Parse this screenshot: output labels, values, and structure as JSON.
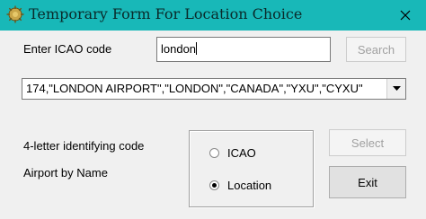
{
  "window": {
    "title": "Temporary Form For Location Choice",
    "close_label": "✕"
  },
  "search": {
    "label": "Enter ICAO code",
    "value": "london",
    "button_label": "Search",
    "button_enabled": false
  },
  "results": {
    "selected_value": "174,\"LONDON AIRPORT\",\"LONDON\",\"CANADA\",\"YXU\",\"CYXU\""
  },
  "options": {
    "label_icao": "4-letter identifying code",
    "label_name": "Airport by Name",
    "radio_icao": "ICAO",
    "radio_location": "Location",
    "selected": "Location"
  },
  "buttons": {
    "select_label": "Select",
    "select_enabled": false,
    "exit_label": "Exit"
  },
  "colors": {
    "titlebar": "#18b8b8",
    "window_bg": "#f0f0f0"
  }
}
